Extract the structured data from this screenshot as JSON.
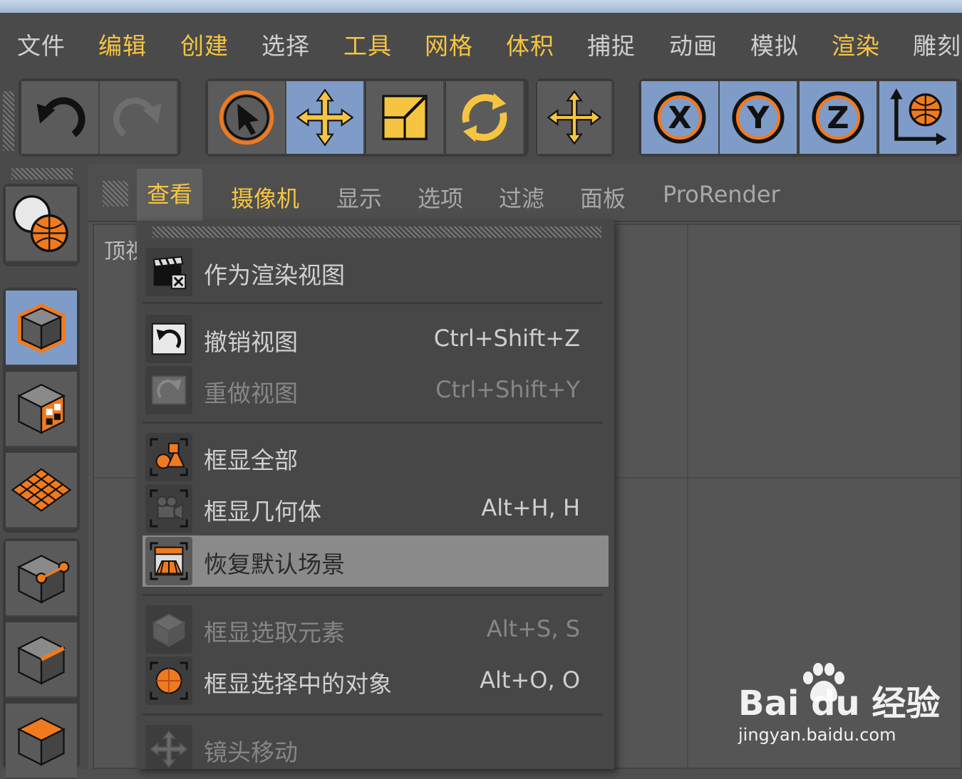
{
  "menubar": {
    "items": [
      "文件",
      "编辑",
      "创建",
      "选择",
      "工具",
      "网格",
      "体积",
      "捕捉",
      "动画",
      "模拟",
      "渲染",
      "雕刻"
    ]
  },
  "viewport": {
    "menu": [
      "查看",
      "摄像机",
      "显示",
      "选项",
      "过滤",
      "面板",
      "ProRender"
    ],
    "view_label": "顶视"
  },
  "dropdown": {
    "items": [
      {
        "label": "作为渲染视图",
        "shortcut": ""
      },
      {
        "label": "撤销视图",
        "shortcut": "Ctrl+Shift+Z"
      },
      {
        "label": "重做视图",
        "shortcut": "Ctrl+Shift+Y"
      },
      {
        "label": "框显全部",
        "shortcut": ""
      },
      {
        "label": "框显几何体",
        "shortcut": "Alt+H, H"
      },
      {
        "label": "恢复默认场景",
        "shortcut": ""
      },
      {
        "label": "框显选取元素",
        "shortcut": "Alt+S, S"
      },
      {
        "label": "框显选择中的对象",
        "shortcut": "Alt+O, O"
      },
      {
        "label": "镜头移动",
        "shortcut": ""
      }
    ]
  },
  "toolbar": {
    "axis_x": "X",
    "axis_y": "Y",
    "axis_z": "Z"
  },
  "watermark": {
    "logo": "Bai du 经验",
    "url": "jingyan.baidu.com"
  },
  "colors": {
    "accent_orange": "#f07a1e",
    "accent_yellow": "#f5c542",
    "active_blue": "#7f9cc8",
    "highlight": "#8a8a8a"
  }
}
